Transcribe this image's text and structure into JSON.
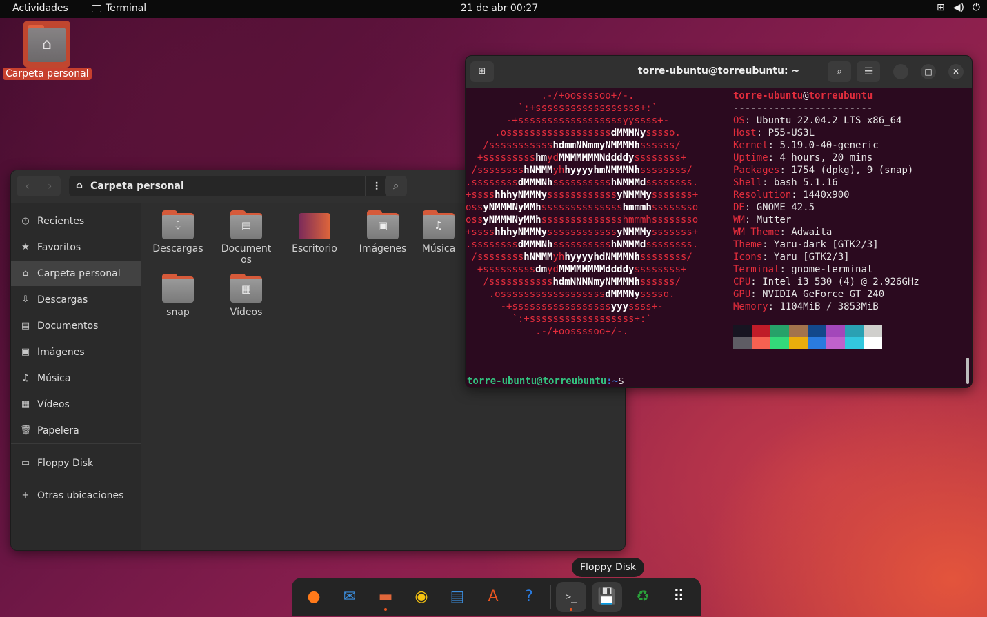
{
  "topbar": {
    "activities": "Actividades",
    "app_name": "Terminal",
    "clock": "21 de abr  00:27"
  },
  "desktop": {
    "home_label": "Carpeta personal"
  },
  "file_manager": {
    "path": "Carpeta personal",
    "sidebar": [
      {
        "icon": "clock-icon",
        "label": "Recientes"
      },
      {
        "icon": "star-icon",
        "label": "Favoritos"
      },
      {
        "icon": "home-icon",
        "label": "Carpeta personal",
        "active": true
      },
      {
        "icon": "download-icon",
        "label": "Descargas"
      },
      {
        "icon": "document-icon",
        "label": "Documentos"
      },
      {
        "icon": "image-icon",
        "label": "Imágenes"
      },
      {
        "icon": "music-icon",
        "label": "Música"
      },
      {
        "icon": "video-icon",
        "label": "Vídeos"
      },
      {
        "icon": "trash-icon",
        "label": "Papelera"
      },
      {
        "icon": "floppy-icon",
        "label": "Floppy Disk"
      },
      {
        "icon": "plus-icon",
        "label": "Otras ubicaciones"
      }
    ],
    "folders": [
      {
        "name": "Descargas",
        "icon": "download-icon"
      },
      {
        "name": "Documentos",
        "icon": "document-icon"
      },
      {
        "name": "Escritorio",
        "icon": "desktop-icon"
      },
      {
        "name": "Imágenes",
        "icon": "image-icon"
      },
      {
        "name": "Música",
        "icon": "music-icon"
      },
      {
        "name": "snap",
        "icon": "folder-icon"
      },
      {
        "name": "Vídeos",
        "icon": "video-icon"
      }
    ]
  },
  "terminal": {
    "title": "torre-ubuntu@torreubuntu: ~",
    "user": "torre-ubuntu",
    "host": "torreubuntu",
    "separator": "------------------------",
    "info": [
      {
        "k": "OS",
        "v": "Ubuntu 22.04.2 LTS x86_64"
      },
      {
        "k": "Host",
        "v": "P55-US3L"
      },
      {
        "k": "Kernel",
        "v": "5.19.0-40-generic"
      },
      {
        "k": "Uptime",
        "v": "4 hours, 20 mins"
      },
      {
        "k": "Packages",
        "v": "1754 (dpkg), 9 (snap)"
      },
      {
        "k": "Shell",
        "v": "bash 5.1.16"
      },
      {
        "k": "Resolution",
        "v": "1440x900"
      },
      {
        "k": "DE",
        "v": "GNOME 42.5"
      },
      {
        "k": "WM",
        "v": "Mutter"
      },
      {
        "k": "WM Theme",
        "v": "Adwaita"
      },
      {
        "k": "Theme",
        "v": "Yaru-dark [GTK2/3]"
      },
      {
        "k": "Icons",
        "v": "Yaru [GTK2/3]"
      },
      {
        "k": "Terminal",
        "v": "gnome-terminal"
      },
      {
        "k": "CPU",
        "v": "Intel i3 530 (4) @ 2.926GHz"
      },
      {
        "k": "GPU",
        "v": "NVIDIA GeForce GT 240"
      },
      {
        "k": "Memory",
        "v": "1104MiB / 3853MiB"
      }
    ],
    "palette": [
      "#171421",
      "#c01c28",
      "#26a269",
      "#a2734c",
      "#12488b",
      "#a347ba",
      "#2aa1b3",
      "#d0cfcc",
      "#5e5c64",
      "#f66151",
      "#33da7a",
      "#e9ad0c",
      "#2a7bde",
      "#c061cb",
      "#33c7de",
      "#ffffff"
    ],
    "prompt_user": "torre-ubuntu@torreubuntu",
    "prompt_path": ":~",
    "prompt_symbol": "$"
  },
  "tooltip": "Floppy Disk",
  "dock": [
    {
      "name": "firefox-icon",
      "glyph": "●",
      "color": "#ff7a1a",
      "running": false
    },
    {
      "name": "thunderbird-icon",
      "glyph": "✉",
      "color": "#3b8fe0",
      "running": false
    },
    {
      "name": "files-icon",
      "glyph": "▬",
      "color": "#e0673a",
      "running": true
    },
    {
      "name": "rhythmbox-icon",
      "glyph": "◉",
      "color": "#f5c211",
      "running": false
    },
    {
      "name": "writer-icon",
      "glyph": "▤",
      "color": "#3b8fe0",
      "running": false
    },
    {
      "name": "app-center-icon",
      "glyph": "A",
      "color": "#e95420",
      "running": false
    },
    {
      "name": "help-icon",
      "glyph": "?",
      "color": "#2a7bde",
      "running": false
    },
    {
      "name": "terminal-icon",
      "glyph": ">_",
      "color": "#cfcfcf",
      "running": true
    },
    {
      "name": "floppy-icon",
      "glyph": "💾",
      "color": "#cfcfcf",
      "running": false
    },
    {
      "name": "trash-icon",
      "glyph": "♻",
      "color": "#2aa13a",
      "running": false
    },
    {
      "name": "show-apps-icon",
      "glyph": "⠿",
      "color": "#ffffff",
      "running": false
    }
  ]
}
